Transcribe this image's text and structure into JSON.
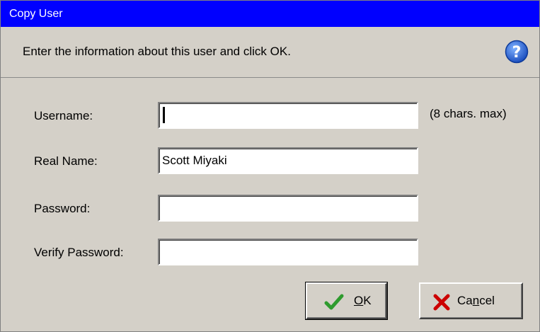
{
  "dialog": {
    "title": "Copy User",
    "instruction": "Enter the information about this user and click OK.",
    "help_icon": "question-circle-icon"
  },
  "form": {
    "username": {
      "label": "Username:",
      "value": "",
      "hint": "(8 chars. max)"
    },
    "real_name": {
      "label": "Real Name:",
      "value": "Scott Miyaki"
    },
    "password": {
      "label": "Password:",
      "value": ""
    },
    "verify_password": {
      "label": "Verify Password:",
      "value": ""
    }
  },
  "buttons": {
    "ok": {
      "mnemonic": "O",
      "rest": "K",
      "icon": "checkmark-icon"
    },
    "cancel": {
      "prefix": "Ca",
      "mnemonic": "n",
      "rest": "cel",
      "icon": "x-mark-icon"
    }
  },
  "colors": {
    "titlebar": "#0000ff",
    "dialog_bg": "#d4d0c8",
    "ok_check": "#2e9b2e",
    "cancel_x": "#cc0000",
    "help_icon": "#1c5fcf"
  }
}
